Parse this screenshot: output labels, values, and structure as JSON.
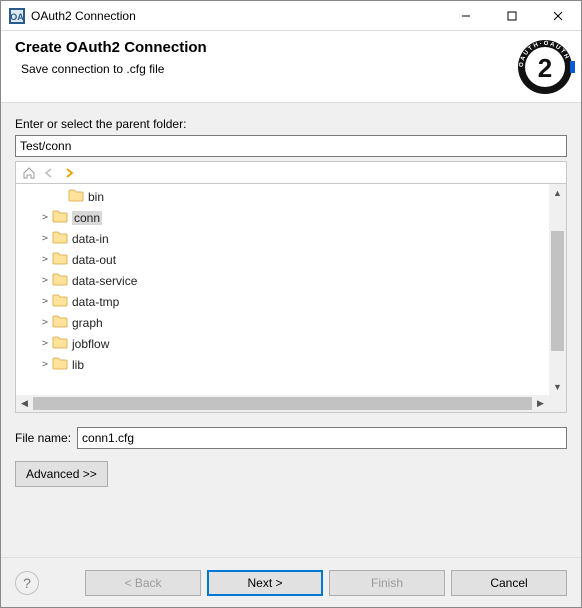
{
  "window": {
    "title": "OAuth2 Connection"
  },
  "header": {
    "title": "Create OAuth2 Connection",
    "subtitle": "Save connection to .cfg file"
  },
  "parent": {
    "label": "Enter or select the parent folder:",
    "value": "Test/conn"
  },
  "toolbar": {
    "home_icon": "home-icon",
    "back_icon": "back-arrow-icon",
    "forward_icon": "forward-arrow-icon"
  },
  "tree": {
    "items": [
      {
        "name": "bin",
        "expandable": false,
        "indent": 2,
        "selected": false
      },
      {
        "name": "conn",
        "expandable": true,
        "indent": 1,
        "selected": true
      },
      {
        "name": "data-in",
        "expandable": true,
        "indent": 1,
        "selected": false
      },
      {
        "name": "data-out",
        "expandable": true,
        "indent": 1,
        "selected": false
      },
      {
        "name": "data-service",
        "expandable": true,
        "indent": 1,
        "selected": false
      },
      {
        "name": "data-tmp",
        "expandable": true,
        "indent": 1,
        "selected": false
      },
      {
        "name": "graph",
        "expandable": true,
        "indent": 1,
        "selected": false
      },
      {
        "name": "jobflow",
        "expandable": true,
        "indent": 1,
        "selected": false
      },
      {
        "name": "lib",
        "expandable": true,
        "indent": 1,
        "selected": false
      }
    ]
  },
  "filename": {
    "label": "File name:",
    "value": "conn1.cfg"
  },
  "advanced": {
    "label": "Advanced >>"
  },
  "buttons": {
    "back": "< Back",
    "next": "Next >",
    "finish": "Finish",
    "cancel": "Cancel"
  }
}
